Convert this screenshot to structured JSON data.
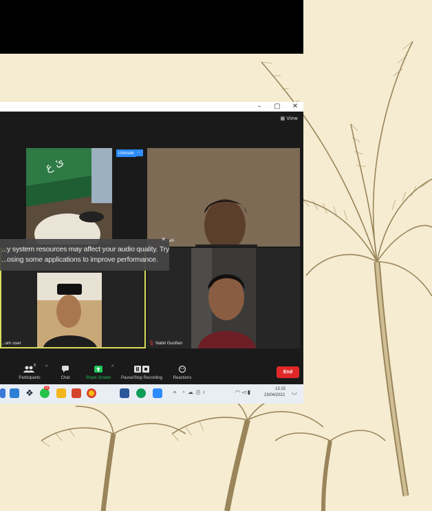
{
  "window": {
    "view_label": "View",
    "minimize_glyph": "–",
    "maximize_glyph": "▢",
    "close_glyph": "✕"
  },
  "tiles": {
    "unmute_label": "Unmute",
    "more_glyph": "···",
    "tile_top_right_name": "...dayati",
    "tile_bottom_left_name": "...om user",
    "tile_bottom_right_name": "Nabil Gusfian"
  },
  "warning": {
    "line1": "...y system resources may affect your audio quality. Try",
    "line2": "...osing some applications to improve performance.",
    "close_glyph": "×"
  },
  "toolbar": {
    "participants_count": "6",
    "participants_label": "Participants",
    "chat_label": "Chat",
    "share_label": "Share Screen",
    "record_label": "Pause/Stop Recording",
    "reactions_label": "Reactions",
    "end_label": "End",
    "caret": "^"
  },
  "taskbar": {
    "badge_count": "10",
    "time": "13:15",
    "date": "23/04/2022"
  },
  "colors": {
    "accent_blue": "#2d8cff",
    "end_red": "#e02828",
    "active_speaker": "#d7e05a",
    "share_green": "#23c55e"
  }
}
